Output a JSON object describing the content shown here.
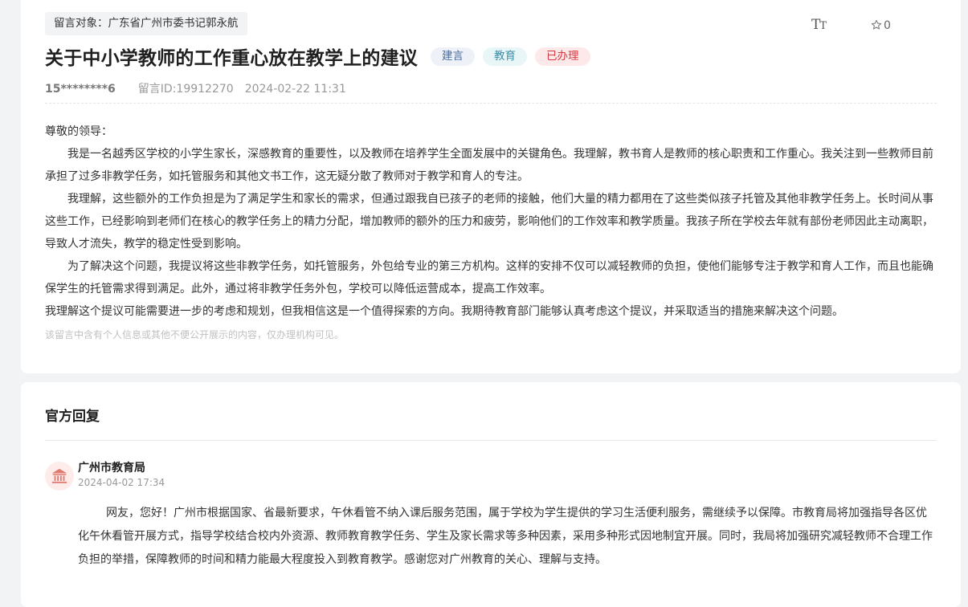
{
  "header": {
    "target_label": "留言对象：广东省广州市委书记郭永航",
    "font_tool_big": "T",
    "font_tool_small": "T",
    "favorite_count": "0"
  },
  "message": {
    "title": "关于中小学教师的工作重心放在教学上的建议",
    "tags": {
      "type": "建言",
      "category": "教育",
      "status": "已办理"
    },
    "colors": {
      "type_tag": "#4a6a9c",
      "category_tag": "#3a8fa8",
      "status_tag": "#d9363e"
    },
    "user": "15********6",
    "message_id": "留言ID:19912270",
    "datetime": "2024-02-22 11:31",
    "greeting": "尊敬的领导：",
    "paragraphs": [
      "我是一名越秀区学校的小学生家长，深感教育的重要性，以及教师在培养学生全面发展中的关键角色。我理解，教书育人是教师的核心职责和工作重心。我关注到一些教师目前承担了过多非教学任务，如托管服务和其他文书工作，这无疑分散了教师对于教学和育人的专注。",
      "我理解，这些额外的工作负担是为了满足学生和家长的需求，但通过跟我自已孩子的老师的接触，他们大量的精力都用在了这些类似孩子托管及其他非教学任务上。长时间从事这些工作，已经影响到老师们在核心的教学任务上的精力分配，增加教师的额外的压力和疲劳，影响他们的工作效率和教学质量。我孩子所在学校去年就有部份老师因此主动离职，导致人才流失，教学的稳定性受到影响。",
      "为了解决这个问题，我提议将这些非教学任务，如托管服务，外包给专业的第三方机构。这样的安排不仅可以减轻教师的负担，使他们能够专注于教学和育人工作，而且也能确保学生的托管需求得到满足。此外，通过将非教学任务外包，学校可以降低运营成本，提高工作效率。"
    ],
    "closing": "我理解这个提议可能需要进一步的考虑和规划，但我相信这是一个值得探索的方向。我期待教育部门能够认真考虑这个提议，并采取适当的措施来解决这个问题。",
    "privacy_note": "该留言中含有个人信息或其他不便公开展示的内容，仅办理机构可见。"
  },
  "reply": {
    "section_title": "官方回复",
    "org_name": "广州市教育局",
    "datetime": "2024-04-02 17:34",
    "text": "网友，您好！广州市根据国家、省最新要求，午休看管不纳入课后服务范围，属于学校为学生提供的学习生活便利服务，需继续予以保障。市教育局将加强指导各区优化午休看管开展方式，指导学校结合校内外资源、教师教育教学任务、学生及家长需求等多种因素，采用多种形式因地制宜开展。同时，我局将加强研究减轻教师不合理工作负担的举措，保障教师的时间和精力能最大程度投入到教育教学。感谢您对广州教育的关心、理解与支持。",
    "icons": {
      "org": "government-building-icon"
    }
  },
  "icons": {
    "font": "font-size-icon",
    "favorite": "star-icon"
  }
}
